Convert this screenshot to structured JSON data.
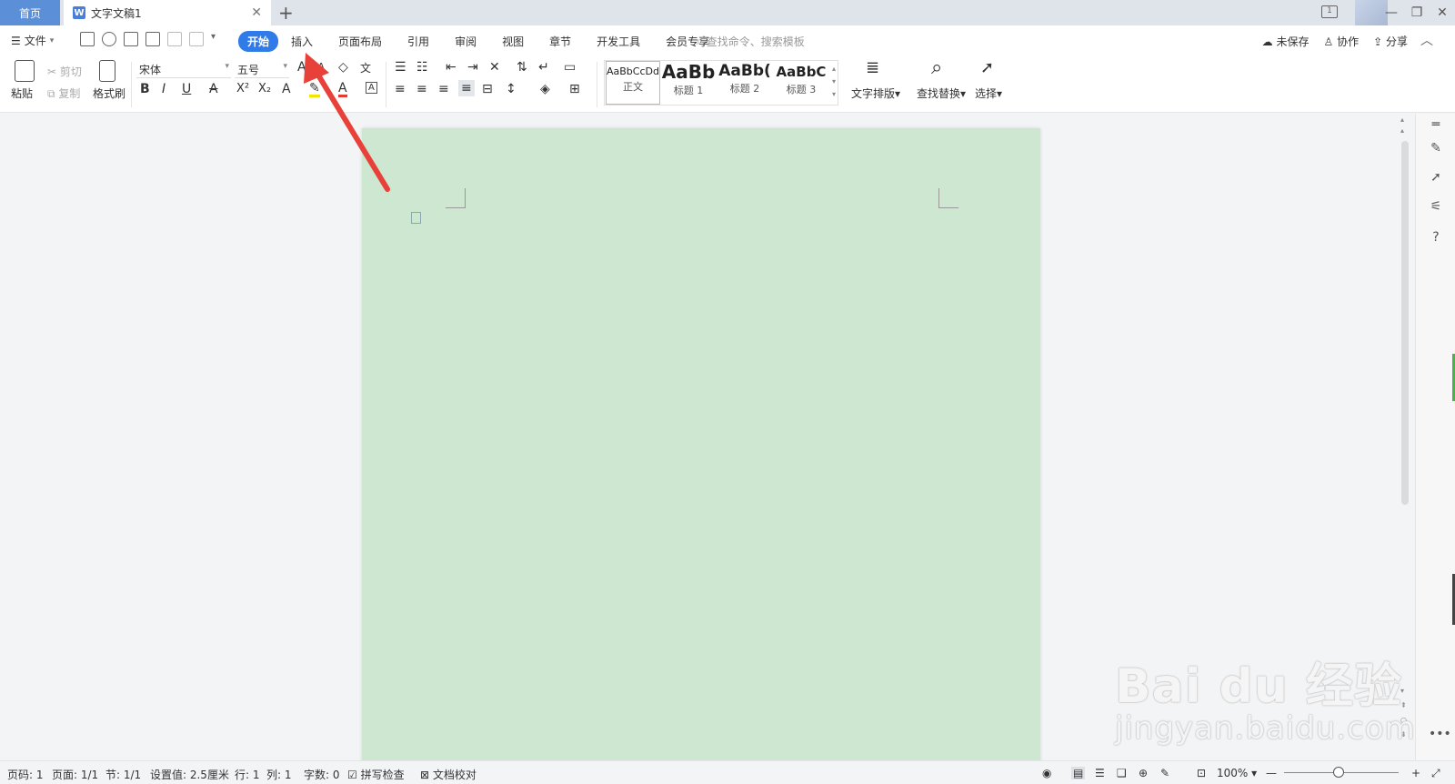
{
  "titlebar": {
    "home_tab": "首页",
    "doc_tab": "文字文稿1",
    "doc_icon": "W",
    "add_tab": "+",
    "reader_badge": "1"
  },
  "menubar": {
    "file": "文件",
    "tabs": [
      "开始",
      "插入",
      "页面布局",
      "引用",
      "审阅",
      "视图",
      "章节",
      "开发工具",
      "会员专享"
    ],
    "active_tab": "开始",
    "search_placeholder": "查找命令、搜索模板",
    "unsaved": "未保存",
    "collab": "协作",
    "share": "分享"
  },
  "ribbon": {
    "paste": "粘贴",
    "cut": "剪切",
    "copy": "复制",
    "format_painter": "格式刷",
    "font_name": "宋体",
    "font_size": "五号",
    "styles": [
      {
        "preview": "AaBbCcDd",
        "name": "正文"
      },
      {
        "preview": "AaBb",
        "name": "标题 1"
      },
      {
        "preview": "AaBb(",
        "name": "标题 2"
      },
      {
        "preview": "AaBbC",
        "name": "标题 3"
      }
    ],
    "text_layout": "文字排版",
    "find_replace": "查找替换",
    "select": "选择"
  },
  "statusbar": {
    "page_num": "页码: 1",
    "pages": "页面: 1/1",
    "section": "节: 1/1",
    "setting": "设置值: 2.5厘米",
    "row": "行: 1",
    "col": "列: 1",
    "word_count": "字数: 0",
    "spell_check": "拼写检查",
    "doc_proof": "文档校对",
    "zoom": "100%"
  },
  "watermark": {
    "main": "Bai du 经验",
    "sub": "jingyan.baidu.com"
  },
  "colors": {
    "accent": "#2f7be8",
    "home_tab": "#5b8fd8",
    "page_bg": "#cde7d0",
    "arrow": "#e8413a"
  }
}
